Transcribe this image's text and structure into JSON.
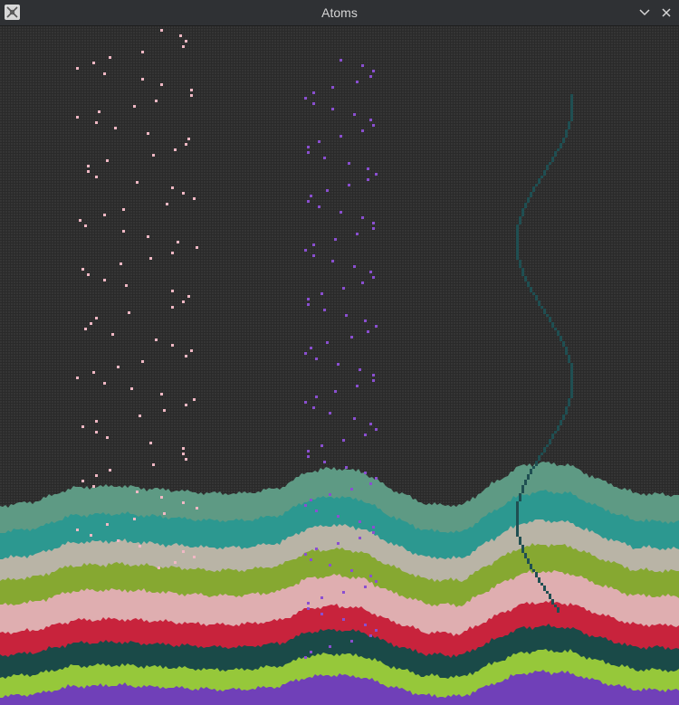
{
  "window": {
    "title": "Atoms",
    "app_icon": "atom-app-icon",
    "controls": [
      {
        "name": "minimize-button",
        "icon": "chevron-down-icon"
      },
      {
        "name": "close-button",
        "icon": "close-icon"
      }
    ]
  },
  "simulation": {
    "background_color": "#2a2a2a",
    "grid_color": "#353535",
    "falling_streams": [
      {
        "name": "pink-stream",
        "color": "#f0b8c4"
      },
      {
        "name": "purple-stream",
        "color": "#8a4fd0"
      },
      {
        "name": "teal-stream",
        "color": "#1f4f52"
      }
    ],
    "sediment_layers": [
      {
        "name": "layer-sage",
        "color": "#5e9a84"
      },
      {
        "name": "layer-teal",
        "color": "#2c9890"
      },
      {
        "name": "layer-stone",
        "color": "#b9b4a6"
      },
      {
        "name": "layer-olive",
        "color": "#86a831"
      },
      {
        "name": "layer-pink",
        "color": "#dfaeb0"
      },
      {
        "name": "layer-crimson",
        "color": "#c8233c"
      },
      {
        "name": "layer-dark-teal",
        "color": "#1a4a48"
      },
      {
        "name": "layer-lime",
        "color": "#96c83a"
      },
      {
        "name": "layer-purple",
        "color": "#7040b8"
      }
    ]
  }
}
